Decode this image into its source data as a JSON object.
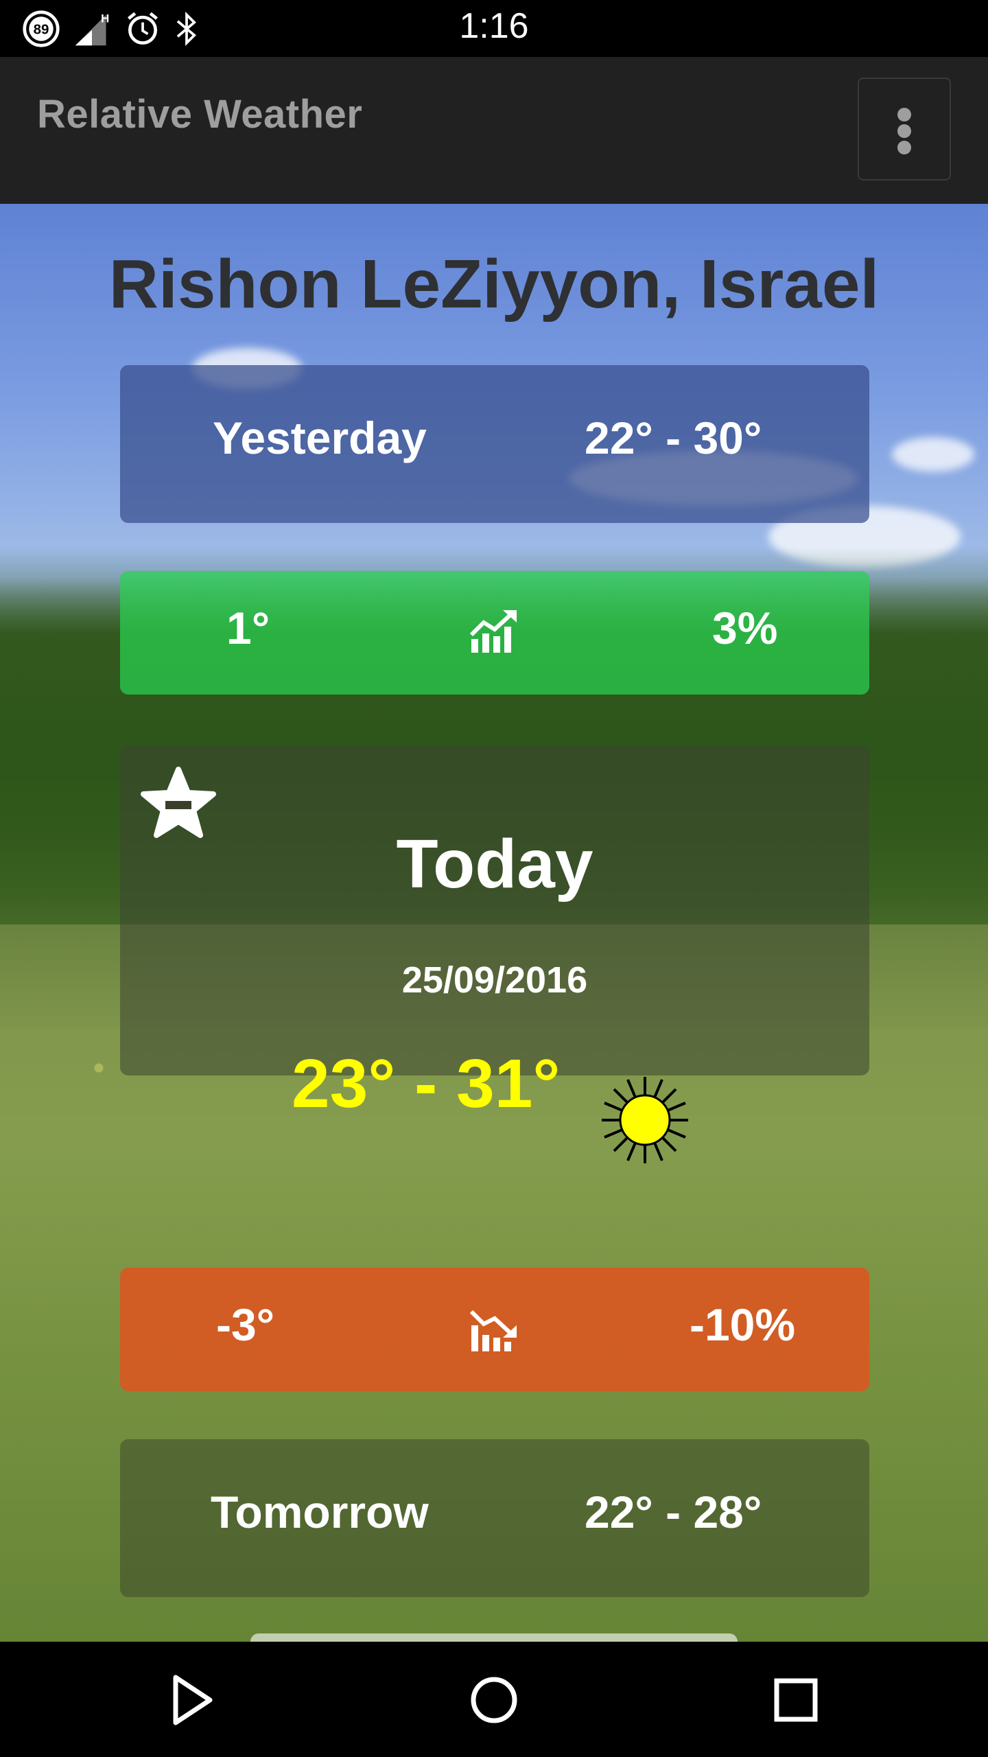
{
  "status_bar": {
    "time": "1:16",
    "battery_level": "89",
    "icons": [
      "battery-icon",
      "signal-icon",
      "alarm-icon",
      "bluetooth-icon"
    ]
  },
  "toolbar": {
    "title": "Relative Weather",
    "overflow_icon": "more-vert-icon"
  },
  "location": "Rishon LeZiyyon, Israel",
  "yesterday": {
    "label": "Yesterday",
    "range": "22° - 30°"
  },
  "diff_up": {
    "degrees": "1°",
    "percent": "3%",
    "icon": "trending-up-icon",
    "color": "#28d250"
  },
  "today": {
    "title": "Today",
    "date": "25/09/2016",
    "range": "23° - 31°",
    "weather_icon": "sun-icon",
    "favorite_icon": "star-remove-icon",
    "range_color": "#ffff00"
  },
  "diff_down": {
    "degrees": "-3°",
    "percent": "-10%",
    "icon": "trending-down-icon",
    "color": "#e0531f"
  },
  "tomorrow": {
    "label": "Tomorrow",
    "range": "22° - 28°"
  },
  "nav": {
    "back": "back-icon",
    "home": "home-icon",
    "recents": "recents-icon"
  }
}
